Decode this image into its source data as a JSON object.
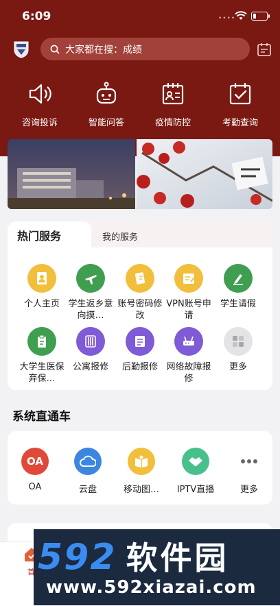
{
  "status_bar": {
    "time": "6:09",
    "dots": "••••"
  },
  "search": {
    "placeholder": "大家都在搜：成绩"
  },
  "quick_actions": [
    {
      "label": "咨询投诉",
      "icon": "speaker-icon"
    },
    {
      "label": "智能问答",
      "icon": "robot-icon"
    },
    {
      "label": "疫情防控",
      "icon": "id-card-calendar-icon"
    },
    {
      "label": "考勤查询",
      "icon": "calendar-check-icon"
    }
  ],
  "services": {
    "tabs": [
      {
        "label": "热门服务",
        "active": true
      },
      {
        "label": "我的服务",
        "active": false
      }
    ],
    "items": [
      {
        "label": "个人主页",
        "color": "#f2bf3c",
        "icon": "profile-icon"
      },
      {
        "label": "学生返乡意向摸…",
        "color": "#3f9e4f",
        "icon": "airplane-icon"
      },
      {
        "label": "账号密码修改",
        "color": "#f2bf3c",
        "icon": "document-edit-icon"
      },
      {
        "label": "VPN账号申请",
        "color": "#f2bf3c",
        "icon": "form-icon"
      },
      {
        "label": "学生请假",
        "color": "#3f9e4f",
        "icon": "pen-icon"
      },
      {
        "label": "大学生医保弃保…",
        "color": "#3f9e4f",
        "icon": "clipboard-icon"
      },
      {
        "label": "公寓报修",
        "color": "#7f5bd6",
        "icon": "grid-icon"
      },
      {
        "label": "后勤报修",
        "color": "#7f5bd6",
        "icon": "report-icon"
      },
      {
        "label": "网络故障报修",
        "color": "#7f5bd6",
        "icon": "router-icon"
      },
      {
        "label": "更多",
        "color": "#e4e4e6",
        "icon": "more-grid-icon"
      }
    ]
  },
  "system": {
    "title": "系统直通车",
    "items": [
      {
        "label": "OA",
        "badge": "OA",
        "color": "#e0493a",
        "icon": "oa-icon"
      },
      {
        "label": "云盘",
        "color": "#3d86e0",
        "icon": "cloud-icon"
      },
      {
        "label": "移动图…",
        "color": "#f2bf3c",
        "icon": "book-icon"
      },
      {
        "label": "IPTV直播",
        "color": "#48c08c",
        "icon": "handshake-icon"
      },
      {
        "label": "更多",
        "color": "#ffffff",
        "icon": "more-dots-icon"
      }
    ]
  },
  "tabbar": {
    "home_label": "首页"
  },
  "watermark": {
    "brand_digits": "592",
    "brand_cn": "软件园",
    "url": "www.592xiazai.com"
  }
}
